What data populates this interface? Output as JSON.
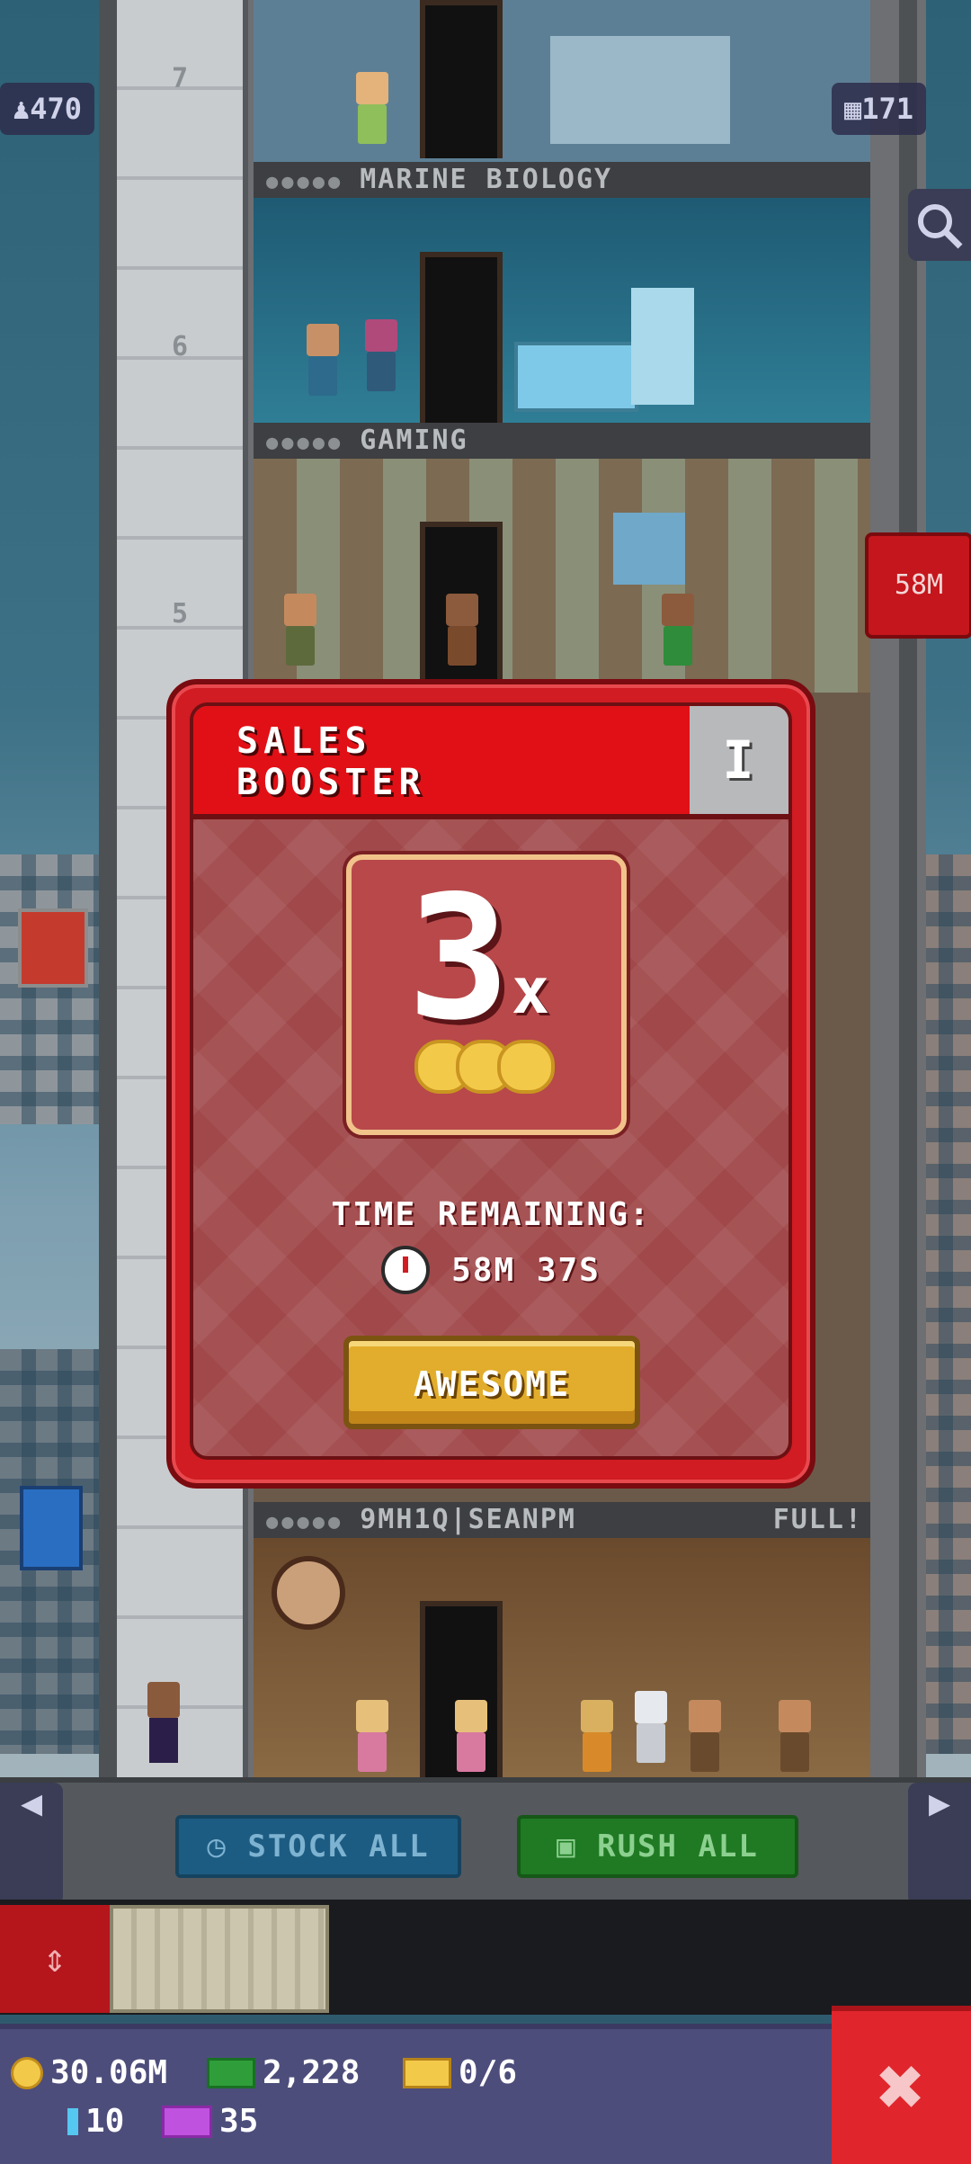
{
  "hud": {
    "population": "470",
    "floors_count": "171",
    "side_timer": "58M"
  },
  "floors": [
    {
      "label": "MARINE BIOLOGY",
      "full": ""
    },
    {
      "label": "GAMING",
      "full": ""
    },
    {
      "label": "9MH1Q|SEANPM",
      "full": "FULL!"
    }
  ],
  "elevator_numbers": [
    "7",
    "6",
    "5"
  ],
  "toolbar": {
    "stock_all": "STOCK ALL",
    "rush_all": "RUSH ALL"
  },
  "modal": {
    "title_line1": "SALES",
    "title_line2": "BOOSTER",
    "info": "i",
    "multiplier": "3",
    "multiplier_suffix": "x",
    "time_label": "TIME REMAINING:",
    "time_value": "58M 37S",
    "confirm": "AWESOME"
  },
  "status": {
    "coins": "30.06M",
    "bux": "2,228",
    "tickets": "0/6",
    "gems": "10",
    "vip": "35"
  },
  "colors": {
    "modal_red": "#d01c22",
    "button_gold": "#e2ad2c",
    "stock_blue": "#1d5c82",
    "rush_green": "#1f7a23"
  }
}
